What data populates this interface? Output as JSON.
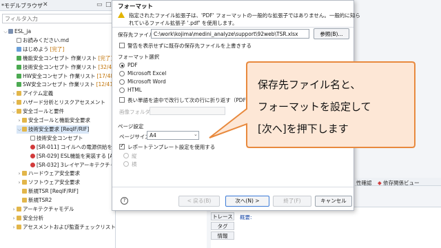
{
  "browser": {
    "title": "*モデルブラウザ",
    "filter_placeholder": "フィルタ入力",
    "items": [
      {
        "label": "ESL_ja",
        "twisty": "⌵",
        "kind": "proj"
      },
      {
        "label": "お読みください.md",
        "twisty": "",
        "kind": "doc"
      },
      {
        "label": "はじめよう",
        "count": "[完了]",
        "twisty": "",
        "kind": "spec"
      },
      {
        "label": "機能安全コンセプト 作業リスト",
        "count": "[完了]",
        "twisty": "",
        "kind": "green"
      },
      {
        "label": "技術安全コンセプト 作業リスト",
        "count": "[32/41]",
        "twisty": "",
        "kind": "green"
      },
      {
        "label": "HW安全コンセプト 作業リスト",
        "count": "[17/48]",
        "twisty": "",
        "kind": "green"
      },
      {
        "label": "SW安全コンセプト 作業リスト",
        "count": "[12/41]",
        "twisty": "",
        "kind": "green"
      },
      {
        "label": "アイテム定義",
        "twisty": "›",
        "kind": "folder"
      },
      {
        "label": "ハザード分析とリスクアセスメント",
        "twisty": "›",
        "kind": "folder"
      },
      {
        "label": "安全ゴールと要件",
        "twisty": "⌵",
        "kind": "folder"
      },
      {
        "label": "安全ゴールと機能安全要求",
        "twisty": "›",
        "kind": "folder"
      },
      {
        "label": "技術安全要求 [ReqIF/RIF]",
        "twisty": "⌵",
        "kind": "folder",
        "selected": true
      },
      {
        "label": "技術安全コンセプト",
        "twisty": "",
        "kind": "doc"
      },
      {
        "label": "[SR-011] コイルへの電源供給を切断",
        "twisty": "",
        "kind": "err"
      },
      {
        "label": "[SR-029] ESL機能を実装する [ASIL",
        "twisty": "",
        "kind": "err"
      },
      {
        "label": "[SR-032] 3レイヤアーキテクチャを適用",
        "twisty": "",
        "kind": "err"
      },
      {
        "label": "ハードウェア安全要求",
        "twisty": "›",
        "kind": "folder"
      },
      {
        "label": "ソフトウェア安全要求",
        "twisty": "›",
        "kind": "folder"
      },
      {
        "label": "新規TSR [ReqIF/RIF]",
        "twisty": "",
        "kind": "folder"
      },
      {
        "label": "新規TSR2",
        "twisty": "",
        "kind": "folder"
      },
      {
        "label": "アーキテクチャモデル",
        "twisty": "›",
        "kind": "folder"
      },
      {
        "label": "安全分析",
        "twisty": "›",
        "kind": "folder"
      },
      {
        "label": "アセスメントおよび監査チェックリスト",
        "twisty": "›",
        "kind": "folder"
      }
    ]
  },
  "editor": {
    "tab_properties": "性確認",
    "tab_dependency": "依存関係ビュー",
    "side_tabs": [
      "トレース",
      "タグ",
      "情報"
    ],
    "summary_label": "概要:"
  },
  "dialog": {
    "title": "フォーマット",
    "warning_line1": "指定されたファイル拡張子は、'PDF' フォーマットの一般的な拡張子ではありません。一般的に知ら",
    "warning_line2": "れているファイル拡張子 '.pdf' を使用します。",
    "path_label": "保存先ファイル:",
    "path_value": "C:\\work\\kojima\\medini_analyze\\support\\92web\\TSR.xlsx",
    "browse_button": "参照(B)...",
    "overwrite_label": "警告を表示せずに既存の保存先ファイルを上書きする",
    "format_group": "フォーマット選択",
    "formats": [
      "PDF",
      "Microsoft Excel",
      "Microsoft Word",
      "HTML"
    ],
    "selected_format": "PDF",
    "wrap_label": "長い単語を途中で改行して次の行に折り返す（PDFのみ",
    "image_folder_label": "画像フォルダ:",
    "page_group": "ページ設定",
    "page_size_label": "ページサイズ:",
    "page_size_value": "A4",
    "use_template_label": "レポートテンプレート設定を使用する",
    "orientations": [
      "縦",
      "横"
    ],
    "buttons": {
      "back": "< 戻る(B)",
      "next": "次へ(N) >",
      "finish": "終了(F)",
      "cancel": "キャンセル"
    }
  },
  "callout": {
    "line1": "保存先ファイル名と、",
    "line2": "フォーマットを設定して",
    "line3": "[次へ]を押下します",
    "fill": "#fde7d6",
    "stroke": "#e8893d"
  }
}
